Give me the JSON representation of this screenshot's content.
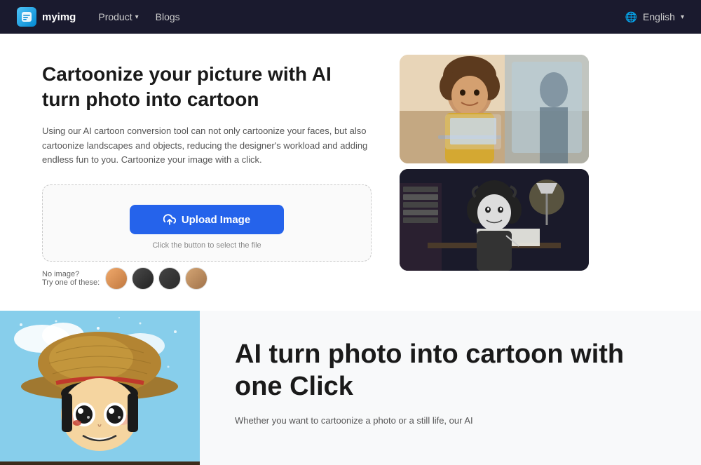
{
  "navbar": {
    "logo_text": "myimg",
    "nav_items": [
      {
        "label": "Product",
        "has_dropdown": true
      },
      {
        "label": "Blogs",
        "has_dropdown": false
      }
    ],
    "language": "English",
    "lang_icon": "🌐"
  },
  "hero": {
    "title": "Cartoonize your picture with AI turn photo into cartoon",
    "description": "Using our AI cartoon conversion tool can not only cartoonize your faces, but also cartoonize landscapes and objects, reducing the designer's workload and adding endless fun to you. Cartoonize your image with a click.",
    "upload_button_label": "Upload Image",
    "upload_hint": "Click the button to select the file",
    "sample_section": {
      "label_no_image": "No image?",
      "label_try": "Try one of these:"
    }
  },
  "second_section": {
    "title": "AI turn photo into cartoon with one Click",
    "description": "Whether you want to cartoonize a photo or a still life, our AI"
  }
}
